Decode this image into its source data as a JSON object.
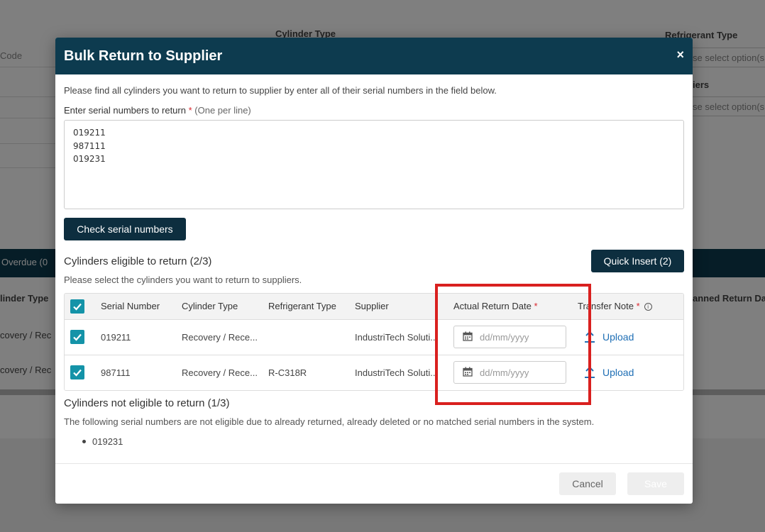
{
  "background": {
    "header_cylinder_type": "Cylinder Type",
    "header_refrigerant_type": "Refrigerant Type",
    "code_placeholder": "Code",
    "select_placeholder_1": "se select option(s",
    "suppliers_label": "iers",
    "select_placeholder_2": "se select option(s",
    "overdue_tab": "Overdue",
    "overdue_count": "(0",
    "col_cylinder_type": "linder Type",
    "col_planned_return": "anned Return Da",
    "row1_cylinder_type": "covery / Rec",
    "row2_cylinder_type": "covery / Rec"
  },
  "modal": {
    "title": "Bulk Return to Supplier",
    "close_label": "×",
    "intro": "Please find all cylinders you want to return to supplier by enter all of their serial numbers in the field below.",
    "serial_label": "Enter serial numbers to return",
    "required_mark": "*",
    "serial_hint": "(One per line)",
    "serial_lines": [
      "019211",
      "987111",
      "019231"
    ],
    "check_button": "Check serial numbers",
    "quick_insert_button": "Quick Insert (2)",
    "eligible_title": "Cylinders eligible to return (2/3)",
    "eligible_hint": "Please select the cylinders you want to return to suppliers.",
    "table": {
      "headers": {
        "serial": "Serial Number",
        "cylinder_type": "Cylinder Type",
        "refrigerant": "Refrigerant Type",
        "supplier": "Supplier",
        "return_date": "Actual Return Date",
        "transfer_note": "Transfer Note"
      },
      "rows": [
        {
          "serial": "019211",
          "cylinder_type": "Recovery / Rece...",
          "refrigerant": "",
          "supplier": "IndustriTech Soluti...",
          "date_placeholder": "dd/mm/yyyy",
          "upload": "Upload",
          "checked": true
        },
        {
          "serial": "987111",
          "cylinder_type": "Recovery / Rece...",
          "refrigerant": "R-C318R",
          "supplier": "IndustriTech Soluti...",
          "date_placeholder": "dd/mm/yyyy",
          "upload": "Upload",
          "checked": true
        }
      ]
    },
    "not_eligible_title": "Cylinders not eligible to return (1/3)",
    "not_eligible_hint": "The following serial numbers are not eligible due to already returned, already deleted or no matched serial numbers in the system.",
    "not_eligible_items": [
      "019231"
    ],
    "cancel_button": "Cancel",
    "save_button": "Save"
  },
  "colors": {
    "header_bg": "#0d3b4f",
    "primary_button": "#0d2e3f",
    "checkbox": "#1493a8",
    "link": "#1f6fb5",
    "required": "#d9272e",
    "highlight_box": "#d9201f"
  }
}
